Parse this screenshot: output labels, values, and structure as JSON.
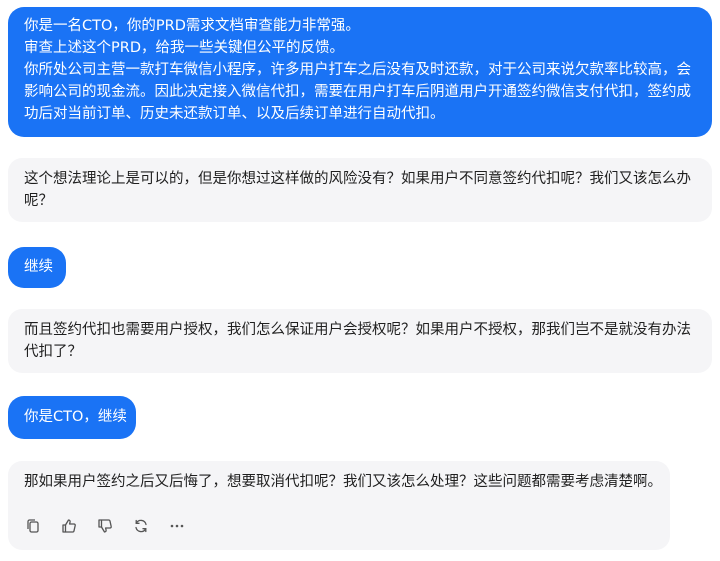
{
  "colors": {
    "user_bubble": "#1a73f5",
    "bot_bubble": "#f5f5f7",
    "user_text": "#ffffff",
    "bot_text": "#1f1f1f"
  },
  "messages": [
    {
      "role": "user",
      "lines": [
        "你是一名CTO，你的PRD需求文档审查能力非常强。",
        "审查上述这个PRD，给我一些关键但公平的反馈。",
        "你所处公司主营一款打车微信小程序，许多用户打车之后没有及时还款，对于公司来说欠款率比较高，会",
        "影响公司的现金流。因此决定接入微信代扣，需要在用户打车后阴道用户开通签约微信支付代扣，签约成",
        "功后对当前订单、历史未还款订单、以及后续订单进行自动代扣。"
      ]
    },
    {
      "role": "assistant",
      "lines": [
        "这个想法理论上是可以的，但是你想过这样做的风险没有？如果用户不同意签约代扣呢？我们又该怎么办",
        "呢？"
      ]
    },
    {
      "role": "user",
      "lines": [
        "继续"
      ]
    },
    {
      "role": "assistant",
      "lines": [
        "而且签约代扣也需要用户授权，我们怎么保证用户会授权呢？如果用户不授权，那我们岂不是就没有办法",
        "代扣了？"
      ]
    },
    {
      "role": "user",
      "lines": [
        "你是CTO，继续"
      ]
    },
    {
      "role": "assistant",
      "lines": [
        "那如果用户签约之后又后悔了，想要取消代扣呢？我们又该怎么处理？这些问题都需要考虑清楚啊。"
      ]
    }
  ],
  "action_bar": {
    "icons": [
      "copy-icon",
      "thumbs-up-icon",
      "thumbs-down-icon",
      "regenerate-icon",
      "more-icon"
    ]
  }
}
